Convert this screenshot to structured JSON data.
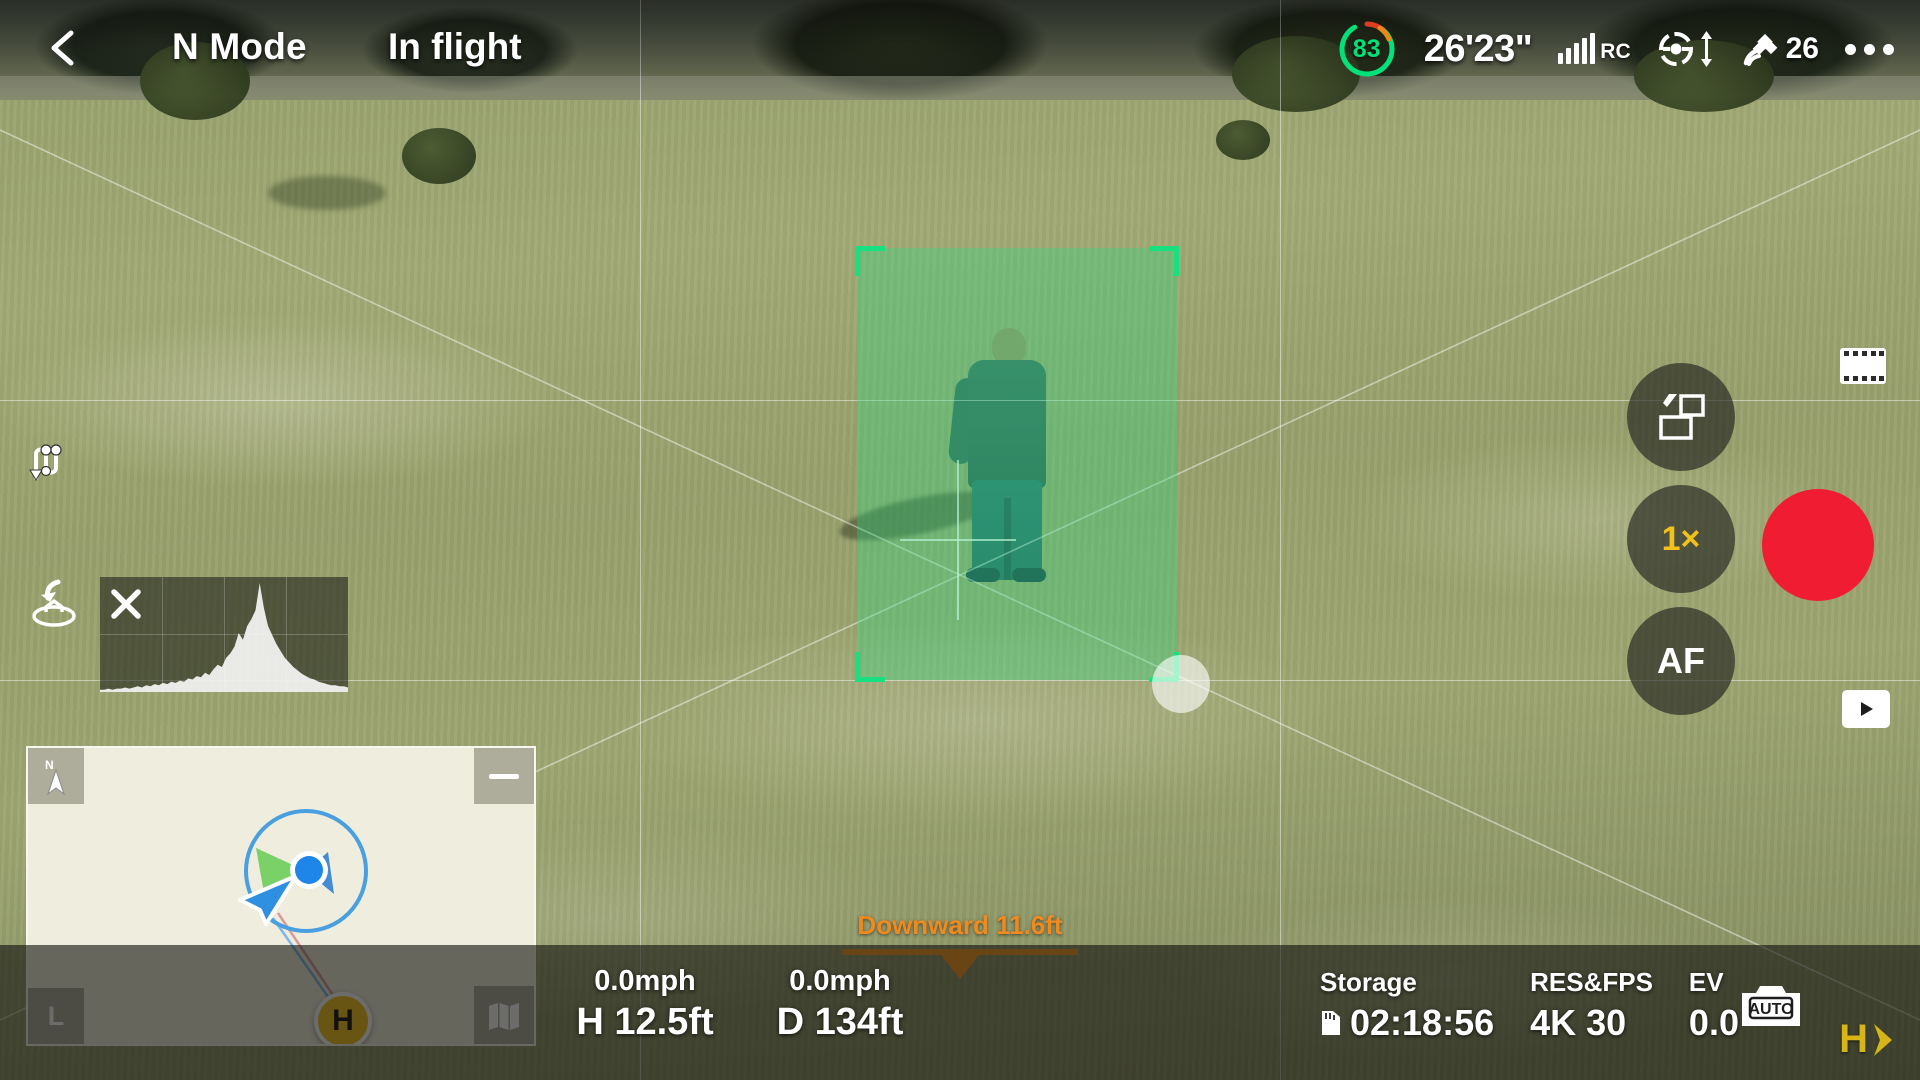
{
  "topbar": {
    "back_icon": "chevron-left-icon",
    "mode": "N Mode",
    "flight_status": "In flight",
    "battery": {
      "percent": "83",
      "ring_color": "#00e17a",
      "warn_color": "#e03c20"
    },
    "flight_time": "26'23\"",
    "rc_signal": {
      "label": "RC",
      "icon": "signal-bars-icon",
      "bars": 5
    },
    "vision_system": {
      "icon": "vision-sensing-icon",
      "arrows": "up-down-arrow-icon"
    },
    "satellite": {
      "icon": "satellite-icon",
      "count": "26"
    },
    "more_menu": {
      "icon": "more-dots-icon"
    }
  },
  "left_panel": {
    "route_icon": "flight-route-icon",
    "rth_icon": "return-to-home-icon",
    "histogram": {
      "close_icon": "close-x-icon",
      "bins": [
        2,
        2,
        3,
        2,
        3,
        3,
        4,
        3,
        4,
        5,
        4,
        6,
        5,
        7,
        6,
        8,
        7,
        9,
        8,
        10,
        9,
        12,
        11,
        14,
        13,
        17,
        15,
        20,
        24,
        22,
        30,
        34,
        40,
        52,
        46,
        58,
        64,
        72,
        96,
        74,
        58,
        50,
        42,
        36,
        30,
        26,
        22,
        19,
        16,
        14,
        12,
        11,
        9,
        8,
        7,
        6,
        6,
        5,
        5,
        4
      ]
    }
  },
  "map": {
    "compass_label": "N",
    "compass_icon": "north-arrow-icon",
    "collapse_icon": "minimize-icon",
    "zoom_label": "L",
    "layers_icon": "map-layers-icon",
    "home_label": "H",
    "drone_marker_icon": "drone-position-icon"
  },
  "tracking": {
    "box_color": "#16e07f",
    "fill_color": "rgba(40,220,130,0.34)",
    "touch_indicator": "touch-point-indicator"
  },
  "obstacle": {
    "label": "Downward 11.6ft",
    "color": "#f79a22"
  },
  "right_controls": {
    "filmstrip_icon": "film-strip-icon",
    "photo_video_toggle_icon": "photo-video-switch-icon",
    "zoom_level": "1×",
    "focus_mode": "AF",
    "record_button": {
      "icon": "record-button",
      "color": "#f01d32"
    },
    "playback_icon": "play-triangle-icon"
  },
  "bottombar": {
    "vertical_speed": "0.0mph",
    "horizontal_speed": "0.0mph",
    "height": "H 12.5ft",
    "distance": "D 134ft",
    "storage": {
      "label": "Storage",
      "icon": "sd-card-icon",
      "value": "02:18:56"
    },
    "res_fps": {
      "label": "RES&FPS",
      "value": "4K 30"
    },
    "ev": {
      "label": "EV",
      "value": "0.0"
    },
    "auto_badge": {
      "icon": "camera-auto-icon",
      "label": "AUTO"
    },
    "home_direction": {
      "label": "H",
      "icon": "home-direction-arrow-icon",
      "color": "#d8b516"
    }
  }
}
